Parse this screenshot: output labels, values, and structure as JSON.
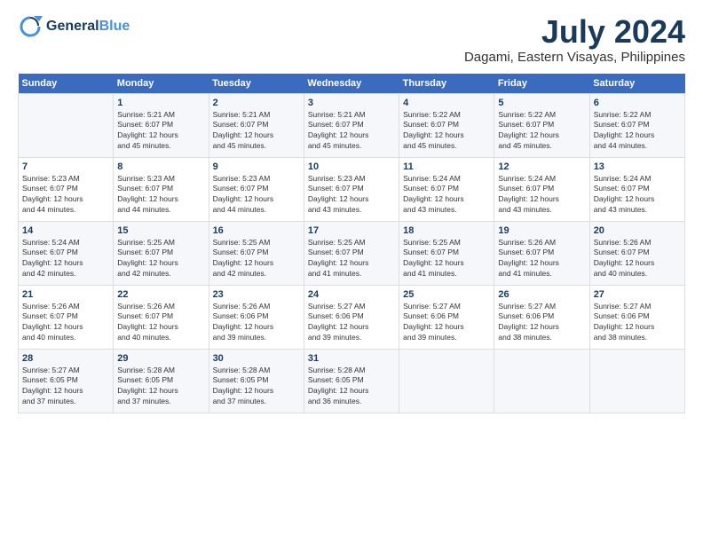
{
  "header": {
    "logo_line1": "General",
    "logo_line2": "Blue",
    "month_year": "July 2024",
    "location": "Dagami, Eastern Visayas, Philippines"
  },
  "weekdays": [
    "Sunday",
    "Monday",
    "Tuesday",
    "Wednesday",
    "Thursday",
    "Friday",
    "Saturday"
  ],
  "weeks": [
    [
      {
        "day": "",
        "info": ""
      },
      {
        "day": "1",
        "info": "Sunrise: 5:21 AM\nSunset: 6:07 PM\nDaylight: 12 hours\nand 45 minutes."
      },
      {
        "day": "2",
        "info": "Sunrise: 5:21 AM\nSunset: 6:07 PM\nDaylight: 12 hours\nand 45 minutes."
      },
      {
        "day": "3",
        "info": "Sunrise: 5:21 AM\nSunset: 6:07 PM\nDaylight: 12 hours\nand 45 minutes."
      },
      {
        "day": "4",
        "info": "Sunrise: 5:22 AM\nSunset: 6:07 PM\nDaylight: 12 hours\nand 45 minutes."
      },
      {
        "day": "5",
        "info": "Sunrise: 5:22 AM\nSunset: 6:07 PM\nDaylight: 12 hours\nand 45 minutes."
      },
      {
        "day": "6",
        "info": "Sunrise: 5:22 AM\nSunset: 6:07 PM\nDaylight: 12 hours\nand 44 minutes."
      }
    ],
    [
      {
        "day": "7",
        "info": "Sunrise: 5:23 AM\nSunset: 6:07 PM\nDaylight: 12 hours\nand 44 minutes."
      },
      {
        "day": "8",
        "info": "Sunrise: 5:23 AM\nSunset: 6:07 PM\nDaylight: 12 hours\nand 44 minutes."
      },
      {
        "day": "9",
        "info": "Sunrise: 5:23 AM\nSunset: 6:07 PM\nDaylight: 12 hours\nand 44 minutes."
      },
      {
        "day": "10",
        "info": "Sunrise: 5:23 AM\nSunset: 6:07 PM\nDaylight: 12 hours\nand 43 minutes."
      },
      {
        "day": "11",
        "info": "Sunrise: 5:24 AM\nSunset: 6:07 PM\nDaylight: 12 hours\nand 43 minutes."
      },
      {
        "day": "12",
        "info": "Sunrise: 5:24 AM\nSunset: 6:07 PM\nDaylight: 12 hours\nand 43 minutes."
      },
      {
        "day": "13",
        "info": "Sunrise: 5:24 AM\nSunset: 6:07 PM\nDaylight: 12 hours\nand 43 minutes."
      }
    ],
    [
      {
        "day": "14",
        "info": "Sunrise: 5:24 AM\nSunset: 6:07 PM\nDaylight: 12 hours\nand 42 minutes."
      },
      {
        "day": "15",
        "info": "Sunrise: 5:25 AM\nSunset: 6:07 PM\nDaylight: 12 hours\nand 42 minutes."
      },
      {
        "day": "16",
        "info": "Sunrise: 5:25 AM\nSunset: 6:07 PM\nDaylight: 12 hours\nand 42 minutes."
      },
      {
        "day": "17",
        "info": "Sunrise: 5:25 AM\nSunset: 6:07 PM\nDaylight: 12 hours\nand 41 minutes."
      },
      {
        "day": "18",
        "info": "Sunrise: 5:25 AM\nSunset: 6:07 PM\nDaylight: 12 hours\nand 41 minutes."
      },
      {
        "day": "19",
        "info": "Sunrise: 5:26 AM\nSunset: 6:07 PM\nDaylight: 12 hours\nand 41 minutes."
      },
      {
        "day": "20",
        "info": "Sunrise: 5:26 AM\nSunset: 6:07 PM\nDaylight: 12 hours\nand 40 minutes."
      }
    ],
    [
      {
        "day": "21",
        "info": "Sunrise: 5:26 AM\nSunset: 6:07 PM\nDaylight: 12 hours\nand 40 minutes."
      },
      {
        "day": "22",
        "info": "Sunrise: 5:26 AM\nSunset: 6:07 PM\nDaylight: 12 hours\nand 40 minutes."
      },
      {
        "day": "23",
        "info": "Sunrise: 5:26 AM\nSunset: 6:06 PM\nDaylight: 12 hours\nand 39 minutes."
      },
      {
        "day": "24",
        "info": "Sunrise: 5:27 AM\nSunset: 6:06 PM\nDaylight: 12 hours\nand 39 minutes."
      },
      {
        "day": "25",
        "info": "Sunrise: 5:27 AM\nSunset: 6:06 PM\nDaylight: 12 hours\nand 39 minutes."
      },
      {
        "day": "26",
        "info": "Sunrise: 5:27 AM\nSunset: 6:06 PM\nDaylight: 12 hours\nand 38 minutes."
      },
      {
        "day": "27",
        "info": "Sunrise: 5:27 AM\nSunset: 6:06 PM\nDaylight: 12 hours\nand 38 minutes."
      }
    ],
    [
      {
        "day": "28",
        "info": "Sunrise: 5:27 AM\nSunset: 6:05 PM\nDaylight: 12 hours\nand 37 minutes."
      },
      {
        "day": "29",
        "info": "Sunrise: 5:28 AM\nSunset: 6:05 PM\nDaylight: 12 hours\nand 37 minutes."
      },
      {
        "day": "30",
        "info": "Sunrise: 5:28 AM\nSunset: 6:05 PM\nDaylight: 12 hours\nand 37 minutes."
      },
      {
        "day": "31",
        "info": "Sunrise: 5:28 AM\nSunset: 6:05 PM\nDaylight: 12 hours\nand 36 minutes."
      },
      {
        "day": "",
        "info": ""
      },
      {
        "day": "",
        "info": ""
      },
      {
        "day": "",
        "info": ""
      }
    ]
  ]
}
